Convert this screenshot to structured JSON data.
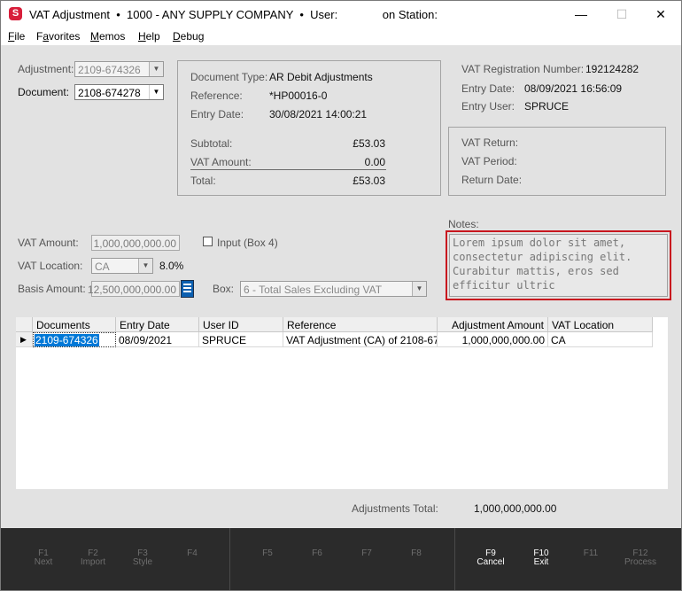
{
  "window": {
    "title_app": "VAT Adjustment",
    "title_company": "1000 - ANY SUPPLY COMPANY",
    "title_user": "User:",
    "title_station": "on Station:",
    "minimize": "—",
    "maximize": "☐",
    "close": "✕"
  },
  "menu": [
    "File",
    "Favorites",
    "Memos",
    "Help",
    "Debug"
  ],
  "menu_mnemonics": [
    "F",
    "a",
    "M",
    "H",
    "D"
  ],
  "form": {
    "adjustment_label": "Adjustment:",
    "adjustment_value": "2109-674326",
    "document_label": "Document:",
    "document_value": "2108-674278"
  },
  "doc_info": {
    "type_label": "Document Type:",
    "type_value": "AR Debit Adjustments",
    "reference_label": "Reference:",
    "reference_value": "*HP00016-0",
    "entry_date_label": "Entry Date:",
    "entry_date_value": "30/08/2021 14:00:21",
    "subtotal_label": "Subtotal:",
    "subtotal_value": "£53.03",
    "vat_amount_label": "VAT Amount:",
    "vat_amount_value": "0.00",
    "total_label": "Total:",
    "total_value": "£53.03"
  },
  "vat_info": {
    "reg_label": "VAT Registration Number:",
    "reg_value": "192124282",
    "entry_date_label": "Entry Date:",
    "entry_date_value": "08/09/2021 16:56:09",
    "entry_user_label": "Entry User:",
    "entry_user_value": "SPRUCE",
    "return_label": "VAT Return:",
    "period_label": "VAT Period:",
    "return_date_label": "Return Date:"
  },
  "vat_fields": {
    "amount_label": "VAT Amount:",
    "amount_value": "1,000,000,000.00",
    "input_box_label": "Input (Box 4)",
    "location_label": "VAT Location:",
    "location_value": "CA",
    "rate": "8.0%",
    "basis_label": "Basis Amount:",
    "basis_value": "12,500,000,000.00",
    "box_label": "Box:",
    "box_value": "6 - Total Sales Excluding VAT"
  },
  "notes": {
    "label": "Notes:",
    "lines": [
      "Lorem ipsum dolor sit amet,",
      "consectetur adipiscing elit.",
      "Curabitur mattis, eros sed",
      "efficitur ultric"
    ]
  },
  "grid": {
    "columns": [
      "Documents",
      "Entry Date",
      "User ID",
      "Reference",
      "Adjustment Amount",
      "VAT Location"
    ],
    "rows": [
      [
        "2109-674326",
        "08/09/2021",
        "SPRUCE",
        "VAT Adjustment (CA) of 2108-67",
        "1,000,000,000.00",
        "CA"
      ]
    ]
  },
  "totals": {
    "label": "Adjustments Total:",
    "value": "1,000,000,000.00"
  },
  "fkeys": [
    {
      "key": "F1",
      "label": "Next",
      "enabled": false
    },
    {
      "key": "F2",
      "label": "Import",
      "enabled": false
    },
    {
      "key": "F3",
      "label": "Style",
      "enabled": false
    },
    {
      "key": "F4",
      "label": "",
      "enabled": false
    },
    {
      "key": "F5",
      "label": "",
      "enabled": false
    },
    {
      "key": "F6",
      "label": "",
      "enabled": false
    },
    {
      "key": "F7",
      "label": "",
      "enabled": false
    },
    {
      "key": "F8",
      "label": "",
      "enabled": false
    },
    {
      "key": "F9",
      "label": "Cancel",
      "enabled": true
    },
    {
      "key": "F10",
      "label": "Exit",
      "enabled": true
    },
    {
      "key": "F11",
      "label": "",
      "enabled": false
    },
    {
      "key": "F12",
      "label": "Process",
      "enabled": false
    }
  ],
  "colors": {
    "accent_red": "#c8161e",
    "selection_blue": "#0078d7",
    "fkey_bar": "#2b2b2b"
  }
}
